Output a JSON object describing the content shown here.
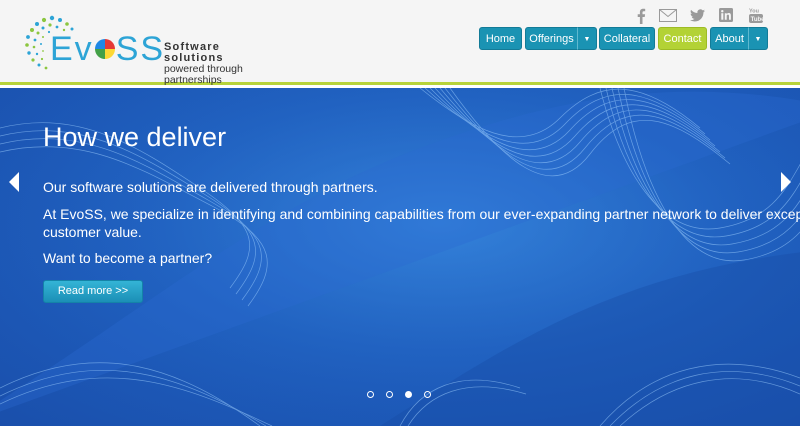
{
  "brand": {
    "name_part1": "Ev",
    "name_part2": "SS",
    "tagline_line1": "Software solutions",
    "tagline_line2": "powered through partnerships"
  },
  "social": [
    "facebook-icon",
    "mail-icon",
    "twitter-icon",
    "linkedin-icon",
    "youtube-icon"
  ],
  "nav": {
    "home": "Home",
    "offerings": "Offerings",
    "collateral": "Collateral",
    "contact": "Contact",
    "about": "About"
  },
  "hero": {
    "title": "How we deliver",
    "line1": "Our software solutions are delivered through partners.",
    "line2a": "At EvoSS, we specialize in identifying and combining capabilities from our ever-expanding partner network to deliver exceptional",
    "line2b": "customer value.",
    "line3": "Want to become a partner?",
    "button": "Read more >>",
    "slide_count": 4,
    "active_slide": 3
  },
  "colors": {
    "accent_green": "#b3d235",
    "nav_teal": "#1a93b3",
    "hero_blue": "#1e5fc0"
  }
}
